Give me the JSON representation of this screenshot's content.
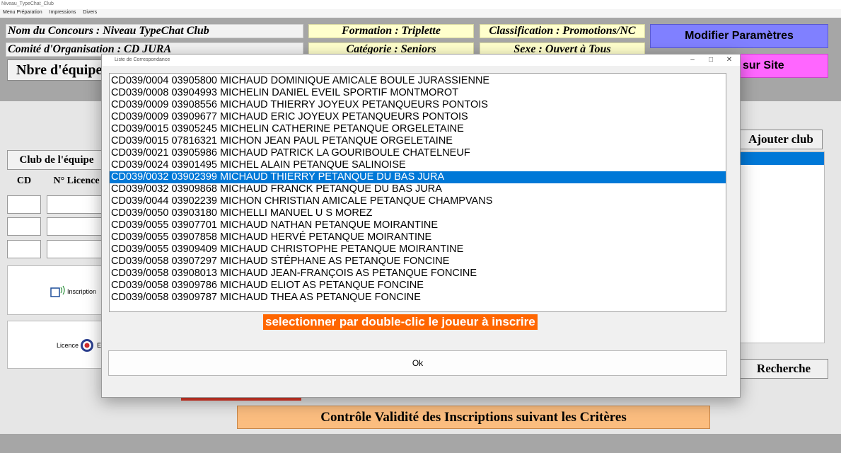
{
  "window": {
    "title": "Niveau_TypeChat_Club"
  },
  "menu": [
    "Menu Préparation",
    "Impressions",
    "Divers"
  ],
  "header": {
    "concours": "Nom du Concours : Niveau  TypeChat  Club",
    "comite": "Comité d'Organisation : CD JURA",
    "formation": "Formation : Triplette",
    "categorie": "Catégorie : Seniors",
    "classification": "Classification : Promotions/NC",
    "sexe": "Sexe : Ouvert à Tous",
    "nbre_equipes": "Nbre d'équipe",
    "modifier_btn": "Modifier Paramètres",
    "site_btn": "sur Site"
  },
  "form": {
    "club_label": "Club de l'équipe",
    "cd_label": "CD",
    "licence_label": "N° Licence",
    "inscription_text": "Inscription",
    "licence_text": "Licence",
    "licence_suffix": "Et"
  },
  "right": {
    "ajouter_btn": "Ajouter club",
    "recherche_btn": "Recherche"
  },
  "controle_btn": "Contrôle Validité des Inscriptions suivant les Critères",
  "dialog": {
    "title": "Liste de Correspondance",
    "min_glyph": "–",
    "max_glyph": "□",
    "close_glyph": "✕",
    "hint": "selectionner par double-clic le joueur à inscrire",
    "ok_label": "Ok",
    "selected_index": 8,
    "rows": [
      "CD039/0004 03905800 MICHAUD DOMINIQUE AMICALE BOULE JURASSIENNE",
      "CD039/0008 03904993 MICHELIN DANIEL EVEIL SPORTIF MONTMOROT",
      "CD039/0009 03908556 MICHAUD THIERRY JOYEUX PETANQUEURS PONTOIS",
      "CD039/0009 03909677 MICHAUD ERIC JOYEUX PETANQUEURS PONTOIS",
      "CD039/0015 03905245 MICHELIN CATHERINE PETANQUE ORGELETAINE",
      "CD039/0015 07816321 MICHON JEAN PAUL PETANQUE ORGELETAINE",
      "CD039/0021 03905986 MICHAUD PATRICK LA GOURIBOULE CHATELNEUF",
      "CD039/0024 03901495 MICHEL ALAIN PETANQUE SALINOISE",
      "CD039/0032 03902399 MICHAUD THIERRY PETANQUE DU BAS JURA",
      "CD039/0032 03909868 MICHAUD FRANCK PETANQUE DU BAS JURA",
      "CD039/0044 03902239 MICHON CHRISTIAN AMICALE PETANQUE CHAMPVANS",
      "CD039/0050 03903180 MICHELLI MANUEL U S  MOREZ",
      "CD039/0055 03907701 MICHAUD NATHAN PETANQUE MOIRANTINE",
      "CD039/0055 03907858 MICHAUD HERVÉ PETANQUE MOIRANTINE",
      "CD039/0055 03909409 MICHAUD CHRISTOPHE PETANQUE MOIRANTINE",
      "CD039/0058 03907297 MICHAUD STÉPHANE AS PETANQUE FONCINE",
      "CD039/0058 03908013 MICHAUD JEAN-FRANÇOIS AS PETANQUE FONCINE",
      "CD039/0058 03909786 MICHAUD ELIOT AS PETANQUE FONCINE",
      "CD039/0058 03909787 MICHAUD THEA AS PETANQUE FONCINE"
    ]
  }
}
